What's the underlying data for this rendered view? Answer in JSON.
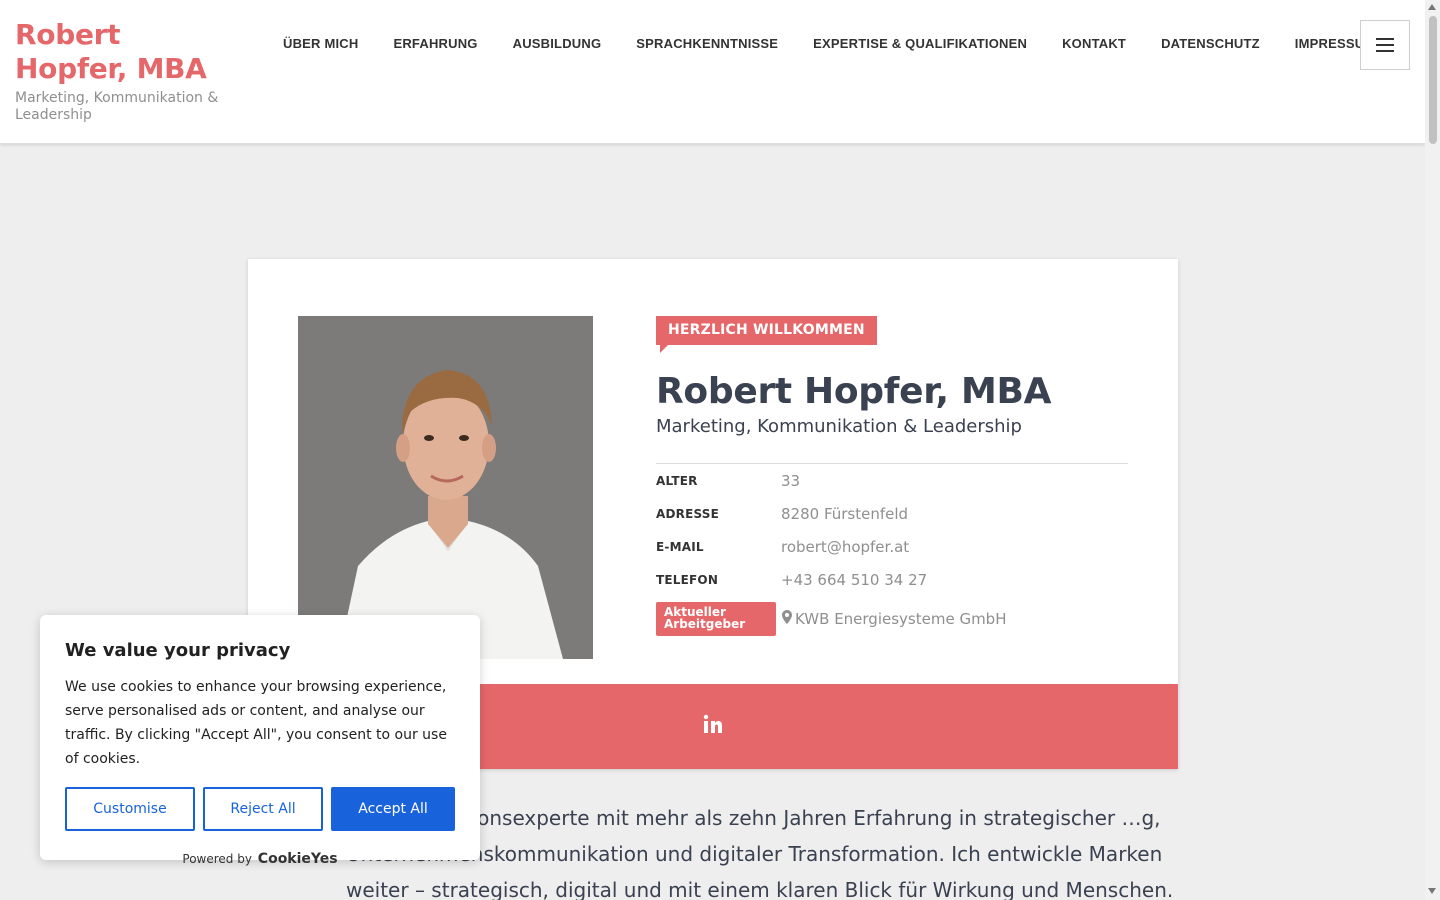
{
  "brand": {
    "title_line1": "Robert",
    "title_line2": "Hopfer, MBA",
    "subtitle": "Marketing, Kommunikation & Leadership"
  },
  "nav": {
    "items": [
      "ÜBER MICH",
      "ERFAHRUNG",
      "AUSBILDUNG",
      "SPRACHKENNTNISSE",
      "EXPERTISE & QUALIFIKATIONEN",
      "KONTAKT",
      "DATENSCHUTZ",
      "IMPRESSUM"
    ]
  },
  "profile": {
    "welcome": "HERZLICH WILLKOMMEN",
    "name": "Robert Hopfer, MBA",
    "role": "Marketing, Kommunikation & Leadership",
    "fields": [
      {
        "label": "ALTER",
        "value": "33"
      },
      {
        "label": "ADRESSE",
        "value": "8280 Fürstenfeld"
      },
      {
        "label": "E-MAIL",
        "value": "robert@hopfer.at"
      },
      {
        "label": "TELEFON",
        "value": "+43 664 510 34 27"
      }
    ],
    "employer_label": "Aktueller Arbeitgeber",
    "employer_value": "KWB Energiesysteme GmbH",
    "social_icon": "linkedin-icon"
  },
  "intro": {
    "text": "Kommunikationsexperte mit mehr als zehn Jahren Erfahrung in strategischer …g, Unternehmenskommunikation und digitaler Transformation. Ich entwickle Marken weiter – strategisch, digital und mit einem klaren Blick für Wirkung und Menschen."
  },
  "cookie": {
    "title": "We value your privacy",
    "text": "We use cookies to enhance your browsing experience, serve personalised ads or content, and analyse our traffic. By clicking \"Accept All\", you consent to our use of cookies.",
    "customise": "Customise",
    "reject": "Reject All",
    "accept": "Accept All",
    "powered_by": "Powered by",
    "powered_brand": "CookieYes"
  },
  "colors": {
    "accent": "#e5676a",
    "heading": "#3a4150",
    "cookie_primary": "#1863dc"
  }
}
